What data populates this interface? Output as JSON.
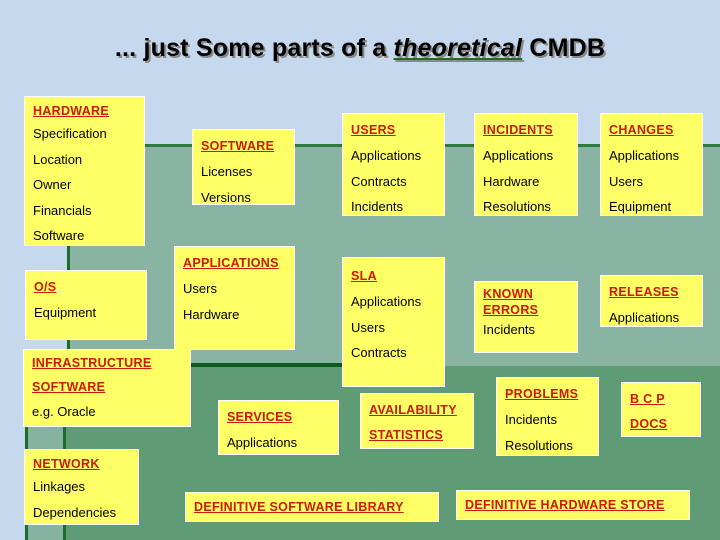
{
  "title": {
    "prefix": "... just Some parts of a ",
    "emphasis": "theoretical",
    "suffix": " CMDB"
  },
  "boxes": {
    "hardware": {
      "heading": "HARDWARE",
      "items": [
        "Specification",
        "Location",
        "Owner",
        "Financials",
        "Software"
      ]
    },
    "software": {
      "heading": "SOFTWARE",
      "items": [
        "Licenses",
        "Versions"
      ]
    },
    "users": {
      "heading": "USERS",
      "items": [
        "Applications",
        "Contracts",
        "Incidents"
      ]
    },
    "incidents": {
      "heading": "INCIDENTS",
      "items": [
        "Applications",
        "Hardware",
        "Resolutions"
      ]
    },
    "changes": {
      "heading": "CHANGES",
      "items": [
        "Applications",
        "Users",
        "Equipment"
      ]
    },
    "os": {
      "heading": "O/S",
      "items": [
        "Equipment"
      ]
    },
    "applications": {
      "heading": "APPLICATIONS",
      "items": [
        "Users",
        "Hardware"
      ]
    },
    "sla": {
      "heading": "SLA",
      "items": [
        "Applications",
        "Users",
        "Contracts"
      ]
    },
    "known_errors": {
      "heading_1": "KNOWN",
      "heading_2": "ERRORS",
      "items": [
        "Incidents"
      ]
    },
    "releases": {
      "heading": "RELEASES",
      "items": [
        "Applications"
      ]
    },
    "infrastructure_software": {
      "heading_1": "INFRASTRUCTURE",
      "heading_2": "SOFTWARE",
      "items": [
        "e.g. Oracle"
      ]
    },
    "services": {
      "heading": "SERVICES",
      "items": [
        "Applications"
      ]
    },
    "availability_statistics": {
      "heading_1": "AVAILABILITY",
      "heading_2": "STATISTICS"
    },
    "problems": {
      "heading": "PROBLEMS",
      "items": [
        "Incidents",
        "Resolutions"
      ]
    },
    "bcp_docs": {
      "heading_1": "B C P",
      "heading_2": "DOCS"
    },
    "network": {
      "heading": "NETWORK",
      "items": [
        "Linkages",
        "Dependencies"
      ]
    },
    "dsl": {
      "heading": "DEFINITIVE SOFTWARE LIBRARY"
    },
    "dhs": {
      "heading": "DEFINITIVE HARDWARE STORE"
    }
  },
  "colors": {
    "background": "#c6d8ee",
    "upper_panel": "#89b4a3",
    "lower_panel": "#5f9c76",
    "connector": "#0f5a1e",
    "box_fill": "#ffff66",
    "heading_text": "#cc1a00"
  }
}
